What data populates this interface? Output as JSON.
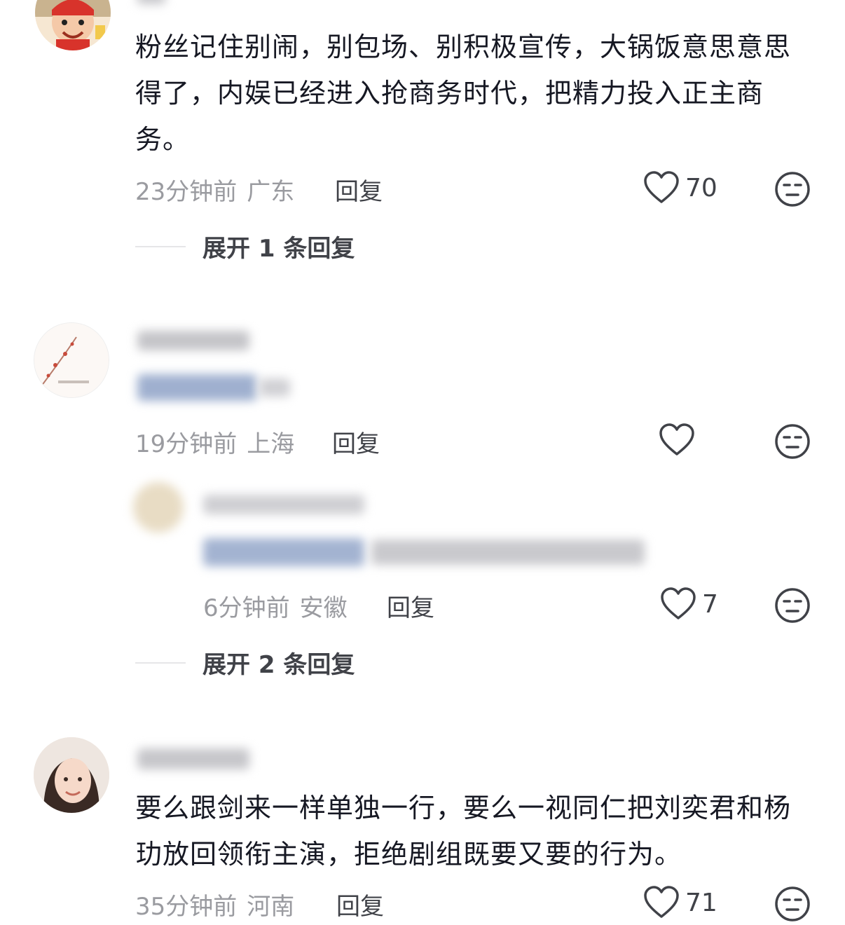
{
  "comments": [
    {
      "text": "粉丝记住别闹，别包场、别积极宣传，大锅饭意思意思得了，内娱已经进入抢商务时代，把精力投入正主商务。",
      "time": "23分钟前",
      "location": "广东",
      "reply_label": "回复",
      "likes": "70",
      "expand_label": "展开 1 条回复"
    },
    {
      "time": "19分钟前",
      "location": "上海",
      "reply_label": "回复",
      "likes": "",
      "sub_reply": {
        "time": "6分钟前",
        "location": "安徽",
        "reply_label": "回复",
        "likes": "7"
      },
      "expand_label": "展开 2 条回复"
    },
    {
      "text": "要么跟剑来一样单独一行，要么一视同仁把刘奕君和杨玏放回领衔主演，拒绝剧组既要又要的行为。",
      "time": "35分钟前",
      "location": "河南",
      "reply_label": "回复",
      "likes": "71"
    }
  ],
  "colors": {
    "text": "#161823",
    "meta": "#9a9ba0",
    "action": "#404248",
    "mention": "#4a6fa5"
  },
  "icons": {
    "like": "heart-outline-icon",
    "dislike": "unamused-face-icon"
  }
}
